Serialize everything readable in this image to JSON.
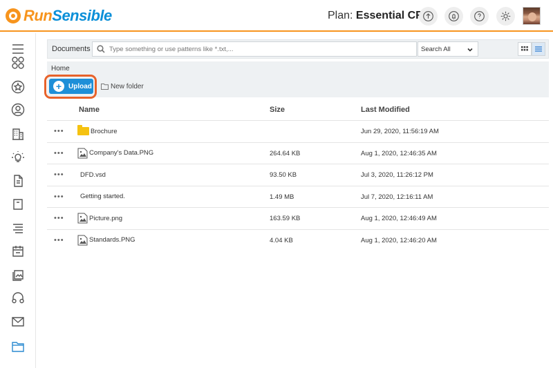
{
  "app": {
    "logo_run": "Run",
    "logo_sensible": "Sensible",
    "plan_label": "Plan:",
    "plan_name": "Essential CRM"
  },
  "colors": {
    "brand_orange": "#f7941d",
    "brand_blue": "#0a8fd8",
    "upload_blue": "#1e8fd8",
    "highlight_ring": "#e8622a",
    "folder_yellow": "#f5c211"
  },
  "top_icons": [
    "phone-up-icon",
    "bell-icon",
    "help-icon",
    "gear-icon"
  ],
  "sidebar": {
    "items": [
      {
        "icon": "menu-icon"
      },
      {
        "icon": "dashboard-icon"
      },
      {
        "icon": "star-icon"
      },
      {
        "icon": "user-icon"
      },
      {
        "icon": "building-icon"
      },
      {
        "icon": "lightbulb-icon"
      },
      {
        "icon": "document-icon"
      },
      {
        "icon": "archive-icon"
      },
      {
        "icon": "list-icon"
      },
      {
        "icon": "calendar-icon"
      },
      {
        "icon": "image-gallery-icon"
      },
      {
        "icon": "headset-icon"
      },
      {
        "icon": "mail-icon"
      },
      {
        "icon": "folder-icon",
        "active": true
      }
    ]
  },
  "toolbar": {
    "documents_label": "Documents",
    "search_placeholder": "Type something or use patterns like *.txt,...",
    "filter_selected": "Search All"
  },
  "breadcrumb": {
    "home": "Home"
  },
  "actions": {
    "upload_label": "Upload",
    "new_folder_label": "New folder"
  },
  "table": {
    "columns": {
      "name": "Name",
      "size": "Size",
      "modified": "Last Modified"
    },
    "rows": [
      {
        "type": "folder",
        "name": "Brochure",
        "size": "",
        "modified": "Jun 29, 2020, 11:56:19 AM"
      },
      {
        "type": "image",
        "name": "Company's Data.PNG",
        "size": "264.64 KB",
        "modified": "Aug 1, 2020, 12:46:35 AM"
      },
      {
        "type": "file",
        "name": "DFD.vsd",
        "size": "93.50 KB",
        "modified": "Jul 3, 2020, 11:26:12 PM"
      },
      {
        "type": "file",
        "name": "Getting started.",
        "size": "1.49 MB",
        "modified": "Jul 7, 2020, 12:16:11 AM"
      },
      {
        "type": "image",
        "name": "Picture.png",
        "size": "163.59 KB",
        "modified": "Aug 1, 2020, 12:46:49 AM"
      },
      {
        "type": "image",
        "name": "Standards.PNG",
        "size": "4.04 KB",
        "modified": "Aug 1, 2020, 12:46:20 AM"
      }
    ]
  }
}
